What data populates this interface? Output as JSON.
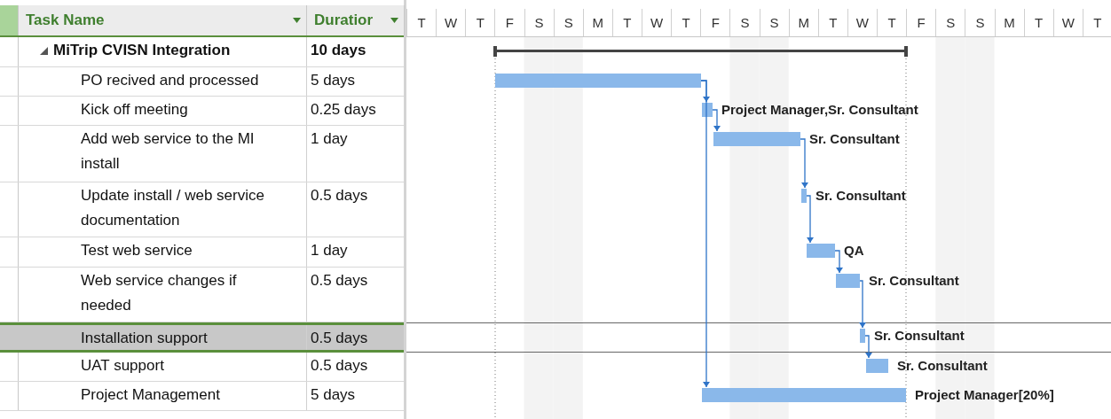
{
  "table": {
    "columns": [
      {
        "label": "Task Name"
      },
      {
        "label": "Duratior"
      }
    ],
    "tasks": [
      {
        "name": "MiTrip CVISN Integration",
        "duration": "10 days",
        "expanded": true,
        "selected": false,
        "children": [
          {
            "name": "PO recived and processed",
            "duration": "5 days",
            "selected": false
          },
          {
            "name": "Kick off meeting",
            "duration": "0.25 days",
            "selected": false,
            "resources": "Project Manager,Sr. Consultant"
          },
          {
            "name": "Add web service to the MI install",
            "duration": "1 day",
            "selected": false,
            "resources": "Sr. Consultant"
          },
          {
            "name": "Update install / web service documentation",
            "duration": "0.5 days",
            "selected": false,
            "resources": "Sr. Consultant"
          },
          {
            "name": "Test web service",
            "duration": "1 day",
            "selected": false,
            "resources": "QA"
          },
          {
            "name": "Web service changes if needed",
            "duration": "0.5 days",
            "selected": false,
            "resources": "Sr. Consultant"
          },
          {
            "name": "Installation support",
            "duration": "0.5 days",
            "selected": true,
            "resources": "Sr. Consultant"
          },
          {
            "name": "UAT support",
            "duration": "0.5 days",
            "selected": false,
            "resources": "Sr. Consultant"
          },
          {
            "name": "Project Management",
            "duration": "5 days",
            "selected": false,
            "resources": "Project Manager[20%]"
          }
        ]
      }
    ]
  },
  "timescale": {
    "days": [
      "T",
      "W",
      "T",
      "F",
      "S",
      "S",
      "M",
      "T",
      "W",
      "T",
      "F",
      "S",
      "S",
      "M",
      "T",
      "W",
      "T",
      "F",
      "S",
      "S",
      "M",
      "T",
      "W",
      "T"
    ]
  }
}
